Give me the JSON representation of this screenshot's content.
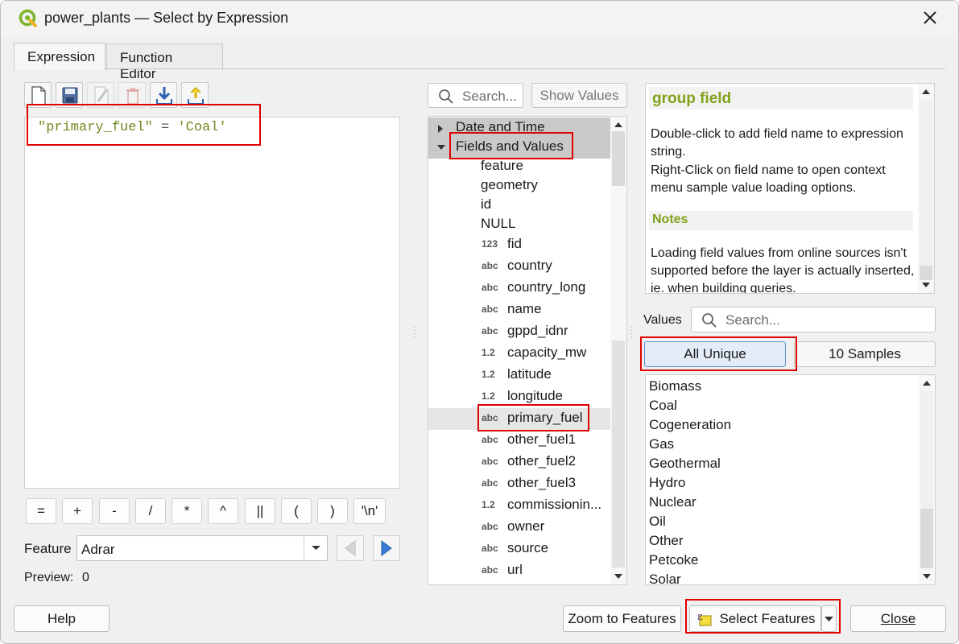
{
  "window": {
    "title": "power_plants — Select by Expression"
  },
  "tabs": [
    {
      "label": "Expression",
      "active": true
    },
    {
      "label": "Function Editor",
      "active": false
    }
  ],
  "toolbar": {
    "icons": [
      "new-file-icon",
      "save-icon",
      "edit-icon",
      "delete-icon",
      "import-icon",
      "export-icon"
    ]
  },
  "expression": {
    "field": "\"primary_fuel\"",
    "operator": " = ",
    "literal": "'Coal'"
  },
  "operators": [
    "=",
    "+",
    "-",
    "/",
    "*",
    "^",
    "||",
    "(",
    ")",
    "'\\n'"
  ],
  "feature": {
    "label": "Feature",
    "value": "Adrar"
  },
  "preview": {
    "label": "Preview:",
    "value": "0"
  },
  "function_search": {
    "placeholder": "Search...",
    "show_values": "Show Values"
  },
  "tree": {
    "groups": [
      {
        "label": "Date and Time",
        "expanded": false
      },
      {
        "label": "Fields and Values",
        "expanded": true
      }
    ],
    "items": [
      {
        "type": "",
        "label": "feature"
      },
      {
        "type": "",
        "label": "geometry"
      },
      {
        "type": "",
        "label": "id"
      },
      {
        "type": "",
        "label": "NULL"
      },
      {
        "type": "123",
        "label": "fid"
      },
      {
        "type": "abc",
        "label": "country"
      },
      {
        "type": "abc",
        "label": "country_long"
      },
      {
        "type": "abc",
        "label": "name"
      },
      {
        "type": "abc",
        "label": "gppd_idnr"
      },
      {
        "type": "1.2",
        "label": "capacity_mw"
      },
      {
        "type": "1.2",
        "label": "latitude"
      },
      {
        "type": "1.2",
        "label": "longitude"
      },
      {
        "type": "abc",
        "label": "primary_fuel"
      },
      {
        "type": "abc",
        "label": "other_fuel1"
      },
      {
        "type": "abc",
        "label": "other_fuel2"
      },
      {
        "type": "abc",
        "label": "other_fuel3"
      },
      {
        "type": "1.2",
        "label": "commissionin..."
      },
      {
        "type": "abc",
        "label": "owner"
      },
      {
        "type": "abc",
        "label": "source"
      },
      {
        "type": "abc",
        "label": "url"
      }
    ]
  },
  "help": {
    "title": "group field",
    "body1": "Double-click to add field name to expression string.",
    "body2": "Right-Click on field name to open context menu sample value loading options.",
    "notes_title": "Notes",
    "notes_body": "Loading field values from online sources isn't supported before the layer is actually inserted, ie. when building queries."
  },
  "values": {
    "label": "Values",
    "search_placeholder": "Search...",
    "all_unique": "All Unique",
    "samples": "10 Samples",
    "items": [
      "Biomass",
      "Coal",
      "Cogeneration",
      "Gas",
      "Geothermal",
      "Hydro",
      "Nuclear",
      "Oil",
      "Other",
      "Petcoke",
      "Solar"
    ]
  },
  "buttons": {
    "help": "Help",
    "zoom": "Zoom to Features",
    "select": "Select Features",
    "close": "Close"
  },
  "colors": {
    "highlight_box": "#e00000",
    "help_title": "#7fa319",
    "expression_text": "#6f8a1f"
  }
}
